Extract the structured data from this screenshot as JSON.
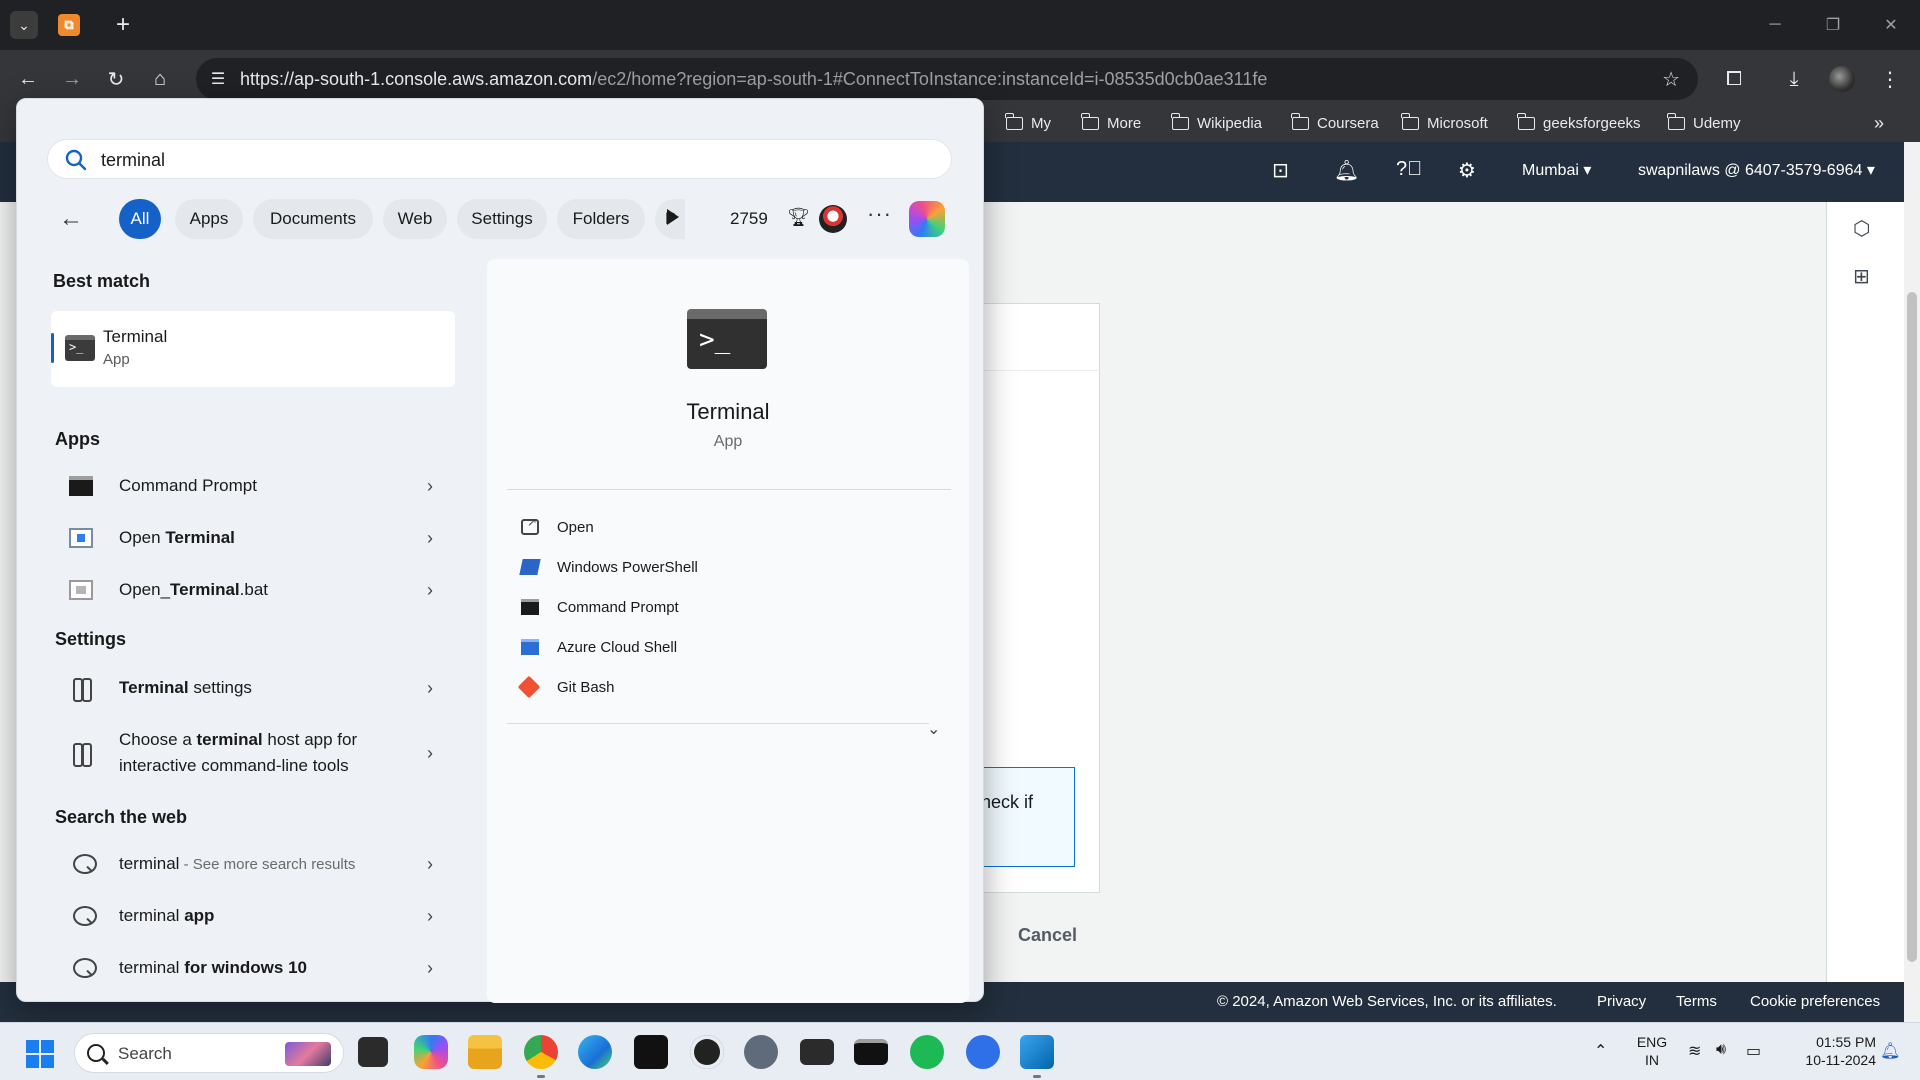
{
  "browser": {
    "tab_list_icon": "chevron-down-icon",
    "tab_favicon": "aws-icon",
    "new_tab": "+",
    "window_controls": [
      "─",
      "❐",
      "✕"
    ],
    "url_host": "https://ap-south-1.console.aws.amazon.com",
    "url_path": "/ec2/home?region=ap-south-1#ConnectToInstance:instanceId=i-08535d0cb0ae311fe",
    "bookmarks": [
      "My",
      "More",
      "Wikipedia",
      "Coursera",
      "Microsoft",
      "geeksforgeeks",
      "Udemy"
    ],
    "bookmarks_overflow": "»"
  },
  "aws": {
    "region": "Mumbai ▾",
    "account": "swapnilaws @ 6407-3579-6964 ▾",
    "info_text": "heck if",
    "cancel_label": "Cancel",
    "footer": {
      "copyright": "© 2024, Amazon Web Services, Inc. or its affiliates.",
      "privacy": "Privacy",
      "terms": "Terms",
      "cookies": "Cookie preferences"
    }
  },
  "search": {
    "query": "terminal",
    "filters": [
      "All",
      "Apps",
      "Documents",
      "Web",
      "Settings",
      "Folders",
      "P"
    ],
    "active_filter": "All",
    "points": "2759",
    "more": "···",
    "best_match_title": "Best match",
    "best_match": {
      "name": "Terminal",
      "type": "App"
    },
    "apps_title": "Apps",
    "apps": [
      {
        "pre": "",
        "bold": "",
        "post": "Command Prompt"
      },
      {
        "pre": "Open ",
        "bold": "Terminal",
        "post": ""
      },
      {
        "pre": "Open_",
        "bold": "Terminal",
        "post": ".bat"
      }
    ],
    "settings_title": "Settings",
    "settings": [
      {
        "line1_bold": "Terminal",
        "line1_post": " settings"
      },
      {
        "line1_pre": "Choose a ",
        "line1_bold": "terminal",
        "line1_post": " host app for",
        "line2": "interactive command-line tools"
      }
    ],
    "web_title": "Search the web",
    "web": [
      {
        "main": "terminal",
        "suffix": " - See more search results"
      },
      {
        "main": "terminal ",
        "bold": "app"
      },
      {
        "main": "terminal ",
        "bold": "for windows 10"
      }
    ],
    "chevron": "›",
    "preview": {
      "name": "Terminal",
      "type": "App",
      "actions": [
        "Open",
        "Windows PowerShell",
        "Command Prompt",
        "Azure Cloud Shell",
        "Git Bash"
      ],
      "expand": "⌄"
    }
  },
  "taskbar": {
    "search_placeholder": "Search",
    "lang_line1": "ENG",
    "lang_line2": "IN",
    "time": "01:55 PM",
    "date": "10-11-2024"
  }
}
